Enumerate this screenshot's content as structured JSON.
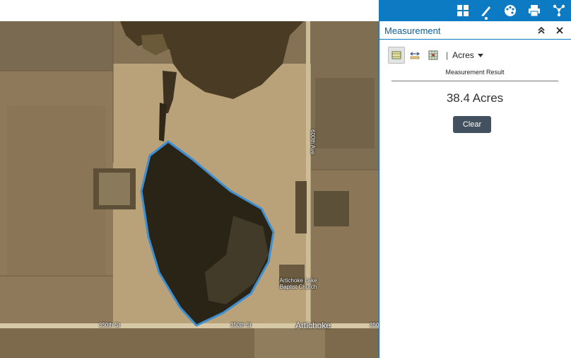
{
  "toolbar": {
    "items": [
      {
        "name": "basemap-gallery",
        "icon": "grid-icon"
      },
      {
        "name": "measurement",
        "icon": "ruler-pencil-icon",
        "active": true
      },
      {
        "name": "layer-styles",
        "icon": "palette-icon"
      },
      {
        "name": "print",
        "icon": "printer-icon"
      },
      {
        "name": "share",
        "icon": "share-icon"
      }
    ],
    "background_color": "#0d7ac4"
  },
  "panel": {
    "title": "Measurement",
    "collapse_icon": "double-chevron-up-icon",
    "close_icon": "close-icon",
    "tools": [
      {
        "name": "area",
        "icon": "area-measure-icon",
        "active": true
      },
      {
        "name": "distance",
        "icon": "distance-measure-icon",
        "active": false
      },
      {
        "name": "location",
        "icon": "location-measure-icon",
        "active": false
      }
    ],
    "separator": "|",
    "unit": "Acres",
    "result_label": "Measurement Result",
    "result_value": "38.4 Acres",
    "clear_label": "Clear",
    "clear_color": "#42505f"
  },
  "map": {
    "labels": {
      "road_south_1": "350th St",
      "road_south_2": "350th St",
      "road_south_3": "350",
      "road_east": "600th Ave",
      "place": "Artichoke",
      "church": "Artichoke Lake Baptist Church"
    },
    "polygon_color": "#3d8fd1"
  }
}
